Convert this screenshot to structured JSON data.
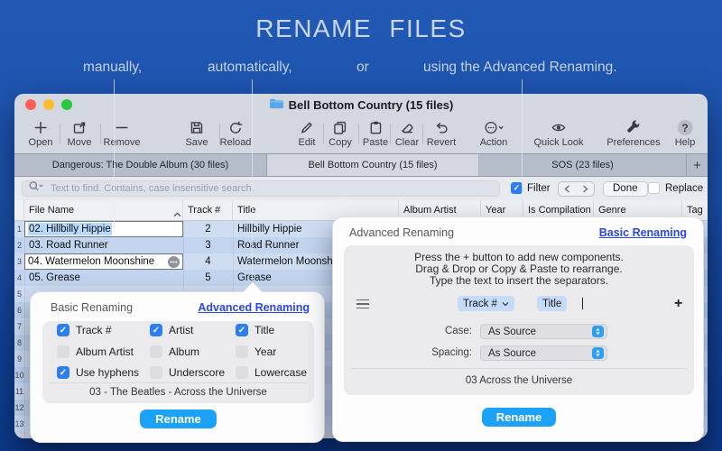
{
  "hero": {
    "title": "RENAME FILES",
    "labels": [
      "manually,",
      "automatically,",
      "or",
      "using the Advanced Renaming."
    ]
  },
  "window": {
    "title": "Bell Bottom Country (15 files)",
    "toolbar": {
      "items": [
        {
          "label": "Open"
        },
        {
          "label": "Move"
        },
        {
          "label": "Remove"
        },
        {
          "label": "Save"
        },
        {
          "label": "Reload"
        },
        {
          "label": "Edit"
        },
        {
          "label": "Copy"
        },
        {
          "label": "Paste"
        },
        {
          "label": "Clear"
        },
        {
          "label": "Revert"
        },
        {
          "label": "Action"
        },
        {
          "label": "Quick Look"
        },
        {
          "label": "Preferences"
        },
        {
          "label": "Help"
        }
      ]
    },
    "tabs": [
      {
        "label": "Dangerous: The Double Album (30 files)",
        "active": false
      },
      {
        "label": "Bell Bottom Country (15 files)",
        "active": true
      },
      {
        "label": "SOS (23 files)",
        "active": false
      }
    ],
    "add_tab_label": "+",
    "search": {
      "placeholder": "Text to find. Contains, case insensitive search.",
      "filter_label": "Filter",
      "filter_checked": true,
      "done_label": "Done",
      "replace_label": "Replace",
      "replace_checked": false
    },
    "table": {
      "columns": [
        "File Name",
        "Track #",
        "Title",
        "Album Artist",
        "Year",
        "Is Compilation",
        "Genre",
        "Tag"
      ],
      "rows": [
        {
          "num": "1",
          "file_name": "02. Hillbilly Hippie",
          "track": "2",
          "title": "Hillbilly Hippie"
        },
        {
          "num": "2",
          "file_name": "03. Road Runner",
          "track": "3",
          "title": "Road Runner"
        },
        {
          "num": "3",
          "file_name": "04. Watermelon Moonshine",
          "track": "4",
          "title": "Watermelon Moonshine"
        },
        {
          "num": "4",
          "file_name": "05. Grease",
          "track": "5",
          "title": "Grease"
        }
      ],
      "filler_nums": [
        "5",
        "6",
        "7",
        "8",
        "9",
        "10",
        "11",
        "12",
        "13"
      ]
    }
  },
  "basic_popover": {
    "title": "Basic Renaming",
    "link": "Advanced Renaming",
    "checkboxes": [
      {
        "label": "Track #",
        "checked": true
      },
      {
        "label": "Artist",
        "checked": true
      },
      {
        "label": "Title",
        "checked": true
      },
      {
        "label": "Album Artist",
        "checked": false
      },
      {
        "label": "Album",
        "checked": false
      },
      {
        "label": "Year",
        "checked": false
      },
      {
        "label": "Use hyphens",
        "checked": true
      },
      {
        "label": "Underscore",
        "checked": false
      },
      {
        "label": "Lowercase",
        "checked": false
      }
    ],
    "preview": "03 - The Beatles - Across the Universe",
    "rename_label": "Rename"
  },
  "advanced_popover": {
    "title": "Advanced Renaming",
    "link": "Basic Renaming",
    "instructions": [
      "Press the + button to add new components.",
      "Drag & Drop or Copy & Paste to rearrange.",
      "Type the text to insert the separators."
    ],
    "components": [
      {
        "label": "Track #"
      },
      {
        "label": "Title"
      }
    ],
    "add_label": "+",
    "case_label": "Case:",
    "case_value": "As Source",
    "spacing_label": "Spacing:",
    "spacing_value": "As Source",
    "preview": "03 Across the Universe",
    "rename_label": "Rename"
  }
}
